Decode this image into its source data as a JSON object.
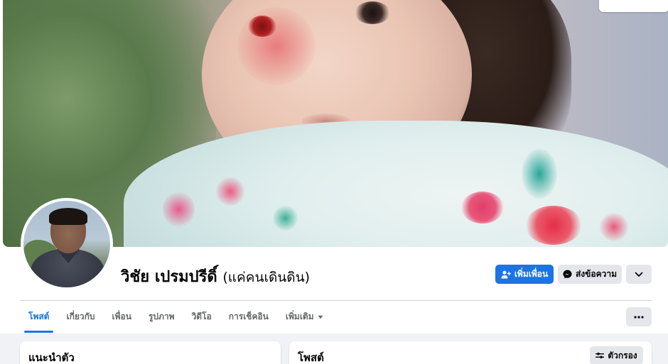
{
  "profile": {
    "name": "วิชัย เปรมปรีดิ์",
    "alternate_name": "(แค่คนเดินดิน)"
  },
  "actions": {
    "add_friend": "เพิ่มเพื่อน",
    "send_message": "ส่งข้อความ"
  },
  "tabs": [
    {
      "label": "โพสต์",
      "icon": ""
    },
    {
      "label": "เกี่ยวกับ",
      "icon": ""
    },
    {
      "label": "เพื่อน",
      "icon": ""
    },
    {
      "label": "รูปภาพ",
      "icon": ""
    },
    {
      "label": "วิดีโอ",
      "icon": ""
    },
    {
      "label": "การเช็คอิน",
      "icon": ""
    },
    {
      "label": "เพิ่มเติม",
      "icon": "caret-down-icon"
    }
  ],
  "cards": {
    "intro_title": "แนะนำตัว",
    "posts_title": "โพสต์",
    "filter_label": "ตัวกรอง"
  },
  "colors": {
    "accent": "#1b74e4",
    "secondary_button": "#e4e6eb",
    "background": "#f0f2f5"
  }
}
